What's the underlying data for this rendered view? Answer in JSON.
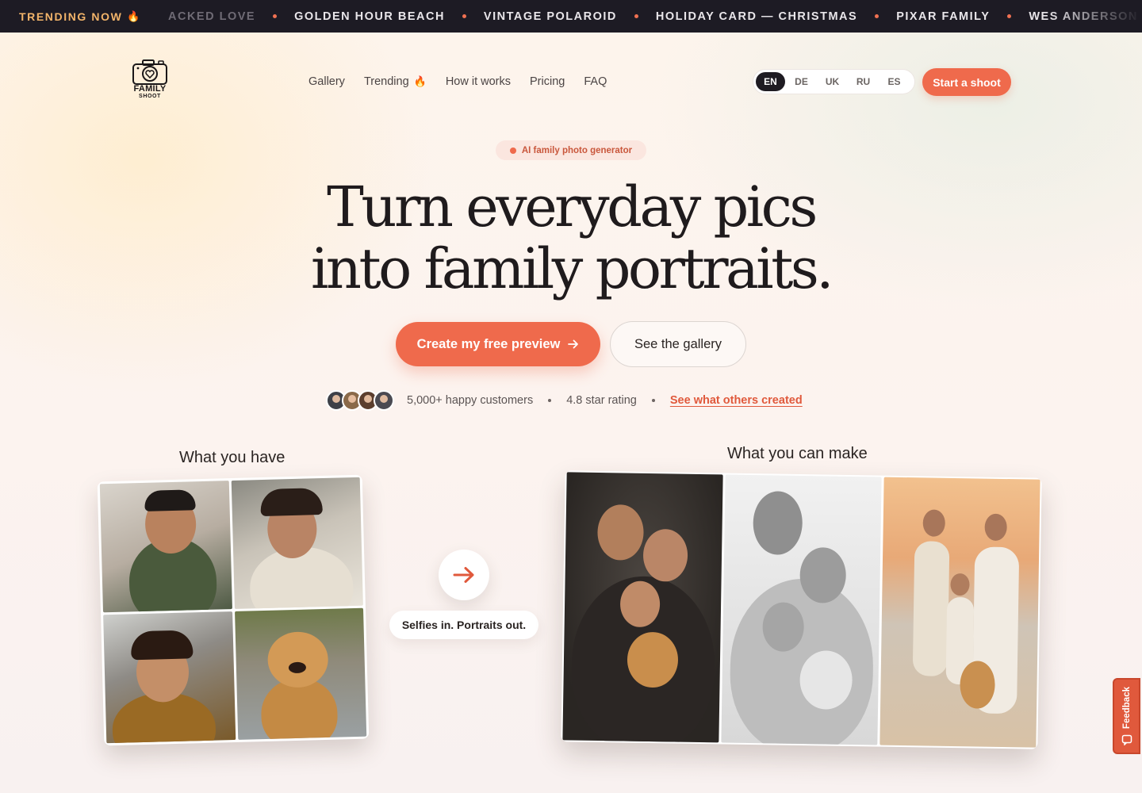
{
  "ticker": {
    "label": "TRENDING NOW",
    "items": [
      "ACKED LOVE",
      "GOLDEN HOUR BEACH",
      "VINTAGE POLAROID",
      "HOLIDAY CARD — CHRISTMAS",
      "PIXAR FAMILY",
      "WES ANDERSON SY"
    ]
  },
  "logo": {
    "line1": "FAMILY",
    "line2": "SHOOT"
  },
  "nav": {
    "items": [
      "Gallery",
      "Trending",
      "How it works",
      "Pricing",
      "FAQ"
    ]
  },
  "languages": {
    "options": [
      "EN",
      "DE",
      "UK",
      "RU",
      "ES"
    ],
    "selected": "EN"
  },
  "header_cta": "Start a shoot",
  "hero": {
    "badge": "AI family photo generator",
    "headline_line1": "Turn everyday pics",
    "headline_line2": "into family portraits.",
    "primary_button": "Create my free preview",
    "secondary_button": "See the gallery"
  },
  "social_proof": {
    "customers": "5,000+ happy customers",
    "rating": "4.8 star rating",
    "link": "See what others created"
  },
  "comparison": {
    "have_label": "What you have",
    "make_label": "What you can make",
    "transition_caption": "Selfies in. Portraits out."
  },
  "feedback_tab": "Feedback",
  "colors": {
    "accent": "#ef6a4c",
    "ticker_bg": "#1d1b24",
    "ticker_label": "#f2b46a",
    "dark_text": "#1f1b1d"
  },
  "icons": {
    "ticker_flame": "flame-icon",
    "nav_flame": "flame-icon",
    "cta_arrow": "arrow-right-icon",
    "transition_arrow": "arrow-right-icon",
    "feedback": "feedback-icon",
    "logo": "camera-heart-icon"
  }
}
